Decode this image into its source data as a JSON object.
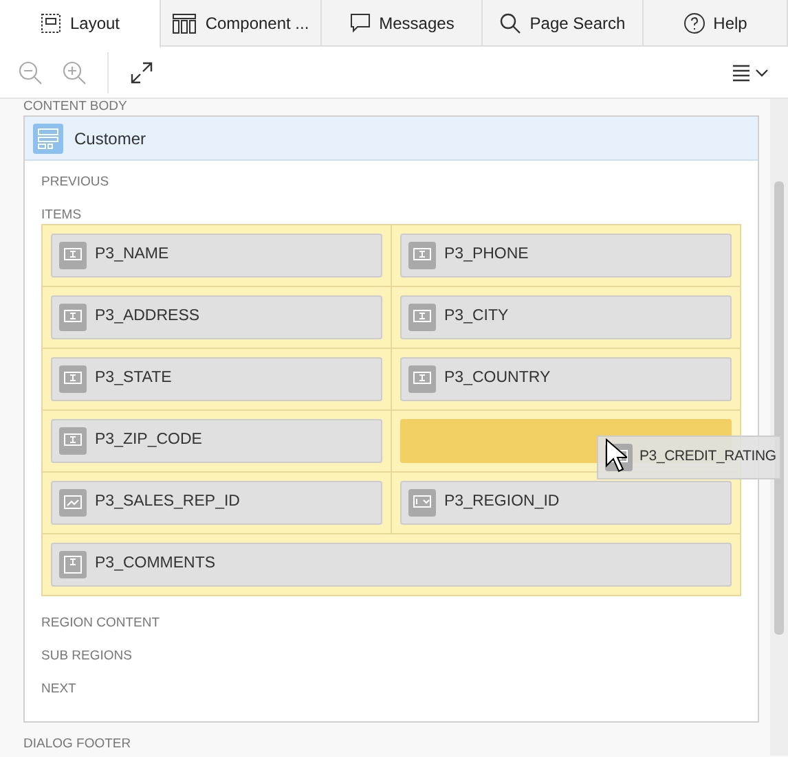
{
  "tabs": [
    {
      "label": "Layout",
      "kind": "layout",
      "selected": true
    },
    {
      "label": "Component ...",
      "kind": "component",
      "selected": false
    },
    {
      "label": "Messages",
      "kind": "messages",
      "selected": false
    },
    {
      "label": "Page Search",
      "kind": "search",
      "selected": false
    },
    {
      "label": "Help",
      "kind": "help",
      "selected": false
    }
  ],
  "toolbar": {
    "zoom_out": {
      "disabled": true
    },
    "zoom_in": {
      "disabled": true
    }
  },
  "canvas": {
    "top_label": "CONTENT BODY",
    "bottom_label": "DIALOG FOOTER",
    "region": {
      "title": "Customer",
      "sections_before": [
        "PREVIOUS"
      ],
      "items_label": "ITEMS",
      "rows": [
        [
          {
            "kind": "text",
            "label": "P3_NAME"
          },
          {
            "kind": "text",
            "label": "P3_PHONE"
          }
        ],
        [
          {
            "kind": "text",
            "label": "P3_ADDRESS"
          },
          {
            "kind": "text",
            "label": "P3_CITY"
          }
        ],
        [
          {
            "kind": "text",
            "label": "P3_STATE"
          },
          {
            "kind": "text",
            "label": "P3_COUNTRY"
          }
        ],
        [
          {
            "kind": "text",
            "label": "P3_ZIP_CODE"
          },
          {
            "kind": "drop"
          }
        ],
        [
          {
            "kind": "popup",
            "label": "P3_SALES_REP_ID"
          },
          {
            "kind": "select",
            "label": "P3_REGION_ID"
          }
        ],
        [
          {
            "kind": "textarea",
            "label": "P3_COMMENTS"
          }
        ]
      ],
      "sections_after": [
        "REGION CONTENT",
        "SUB REGIONS",
        "NEXT"
      ]
    },
    "dragged_item": {
      "kind": "text",
      "label": "P3_CREDIT_RATING"
    }
  }
}
